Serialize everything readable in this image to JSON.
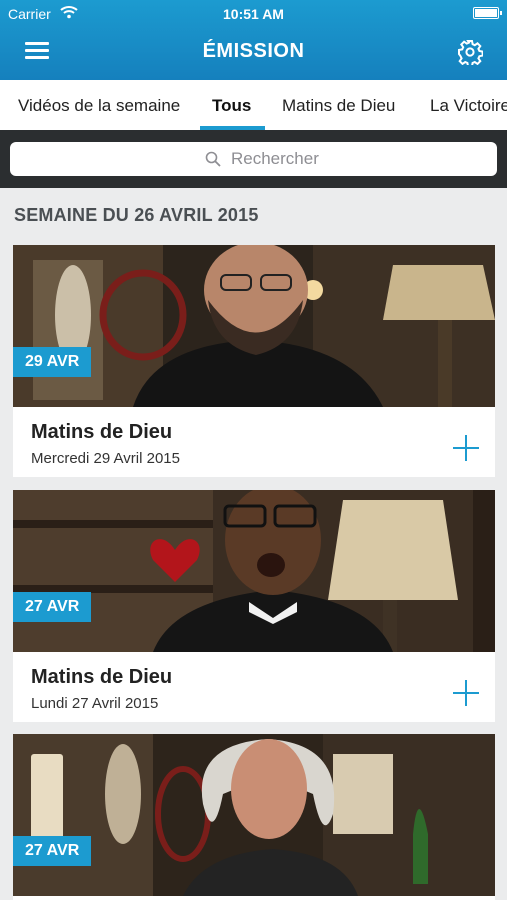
{
  "status_bar": {
    "carrier": "Carrier",
    "time": "10:51 AM"
  },
  "header": {
    "title": "ÉMISSION"
  },
  "tabs": [
    {
      "label": "Vidéos de la semaine"
    },
    {
      "label": "Tous",
      "active": true
    },
    {
      "label": "Matins de Dieu"
    },
    {
      "label": "La Victoire"
    }
  ],
  "search": {
    "placeholder": "Rechercher"
  },
  "section": {
    "title": "SEMAINE DU 26 AVRIL 2015"
  },
  "cards": [
    {
      "badge": "29 AVR",
      "title": "Matins de Dieu",
      "date": "Mercredi 29 Avril 2015"
    },
    {
      "badge": "27 AVR",
      "title": "Matins de Dieu",
      "date": "Lundi 27 Avril 2015"
    },
    {
      "badge": "27 AVR",
      "title": "",
      "date": ""
    }
  ],
  "colors": {
    "accent": "#1c9bd0",
    "header_top": "#1c9bd0",
    "header_bottom": "#1580bd",
    "search_bar_bg": "#2b2e30",
    "page_bg": "#ebeced"
  },
  "icons": {
    "menu": "hamburger-icon",
    "settings": "gear-icon",
    "search": "search-icon",
    "add": "plus-icon",
    "wifi": "wifi-icon",
    "battery": "battery-icon"
  }
}
